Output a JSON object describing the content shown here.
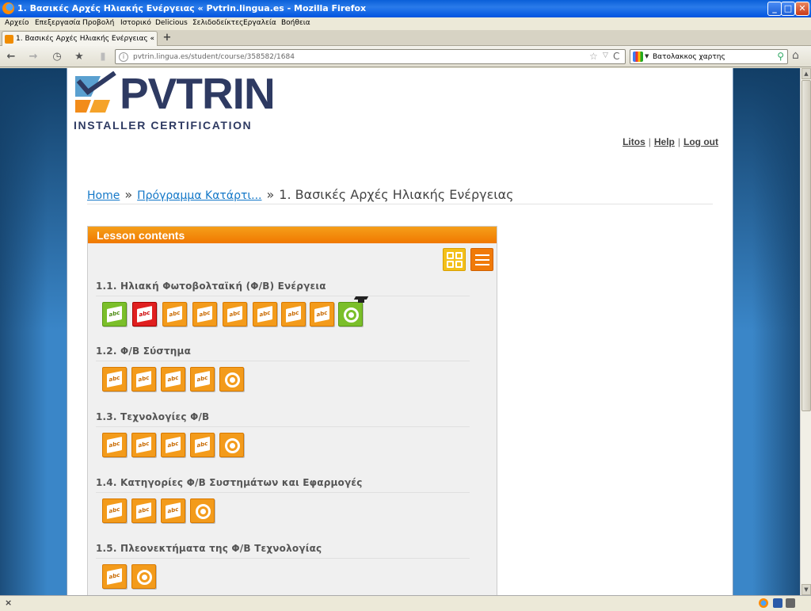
{
  "window": {
    "title": "1. Βασικές Αρχές Ηλιακής Ενέργειας « Pvtrin.lingua.es - Mozilla Firefox",
    "min_glyph": "_",
    "max_glyph": "□",
    "close_glyph": "✕"
  },
  "menu": [
    "Αρχείο",
    "Επεξεργασία",
    "Προβολή",
    "Ιστορικό",
    "Delicious",
    "Σελιδοδείκτες",
    "Εργαλεία",
    "Βοήθεια"
  ],
  "tab": {
    "title": "1. Βασικές Αρχές Ηλιακής Ενέργειας « Pvtrin...",
    "new_tab_glyph": "+"
  },
  "nav": {
    "back_glyph": "←",
    "forward_glyph": "→",
    "history_glyph": "◷",
    "bookmark_glyph": "★",
    "signal_glyph": "▮",
    "url": "pvtrin.lingua.es/student/course/358582/1684",
    "site_glyph": "i",
    "star_glyph": "☆",
    "dropdown_glyph": "▽",
    "reload_glyph": "C",
    "search_query": "Βατολακκος χαρτης",
    "search_caret": "▼",
    "search_glyph": "⚲",
    "home_glyph": "⌂"
  },
  "scroll": {
    "up_glyph": "▲",
    "down_glyph": "▼"
  },
  "site": {
    "logo_text": "PVTRIN",
    "logo_sub": "INSTALLER CERTIFICATION",
    "links": {
      "user": "Litos",
      "sep": "|",
      "help": "Help",
      "logout": "Log out"
    }
  },
  "breadcrumb": {
    "home": "Home",
    "separator": "»",
    "program": "Πρόγραμμα Κατάρτι...",
    "current": "1. Βασικές Αρχές Ηλιακής Ενέργειας"
  },
  "lesson": {
    "header": "Lesson contents",
    "book_label": "abc",
    "sections": [
      {
        "title": "1.1. Ηλιακή Φωτοβολταϊκή (Φ/Β) Ενέργεια",
        "items": [
          "done",
          "failed",
          "book",
          "book",
          "book",
          "book",
          "book",
          "book",
          "test-passed"
        ]
      },
      {
        "title": "1.2. Φ/Β Σύστημα",
        "items": [
          "book",
          "book",
          "book",
          "book",
          "test"
        ]
      },
      {
        "title": "1.3. Τεχνολογίες Φ/Β",
        "items": [
          "book",
          "book",
          "book",
          "book",
          "test"
        ]
      },
      {
        "title": "1.4. Κατηγορίες Φ/Β Συστημάτων και Εφαρμογές",
        "items": [
          "book",
          "book",
          "book",
          "test"
        ]
      },
      {
        "title": "1.5. Πλεονεκτήματα της Φ/Β Τεχνολογίας",
        "items": [
          "book",
          "test"
        ]
      }
    ]
  },
  "status": {
    "close_glyph": "×"
  },
  "icons": {
    "firefox": "firefox-icon",
    "back": "back-arrow-icon",
    "forward": "forward-arrow-icon",
    "history": "history-icon",
    "bookmark": "bookmark-icon",
    "home": "home-icon",
    "grid": "grid-view-icon",
    "list": "list-view-icon",
    "cap": "graduation-cap-icon"
  },
  "colors": {
    "accent": "#f07800",
    "brand": "#2e3a62",
    "link": "#1478c8",
    "done": "#7bbf2a",
    "failed": "#e02020"
  }
}
